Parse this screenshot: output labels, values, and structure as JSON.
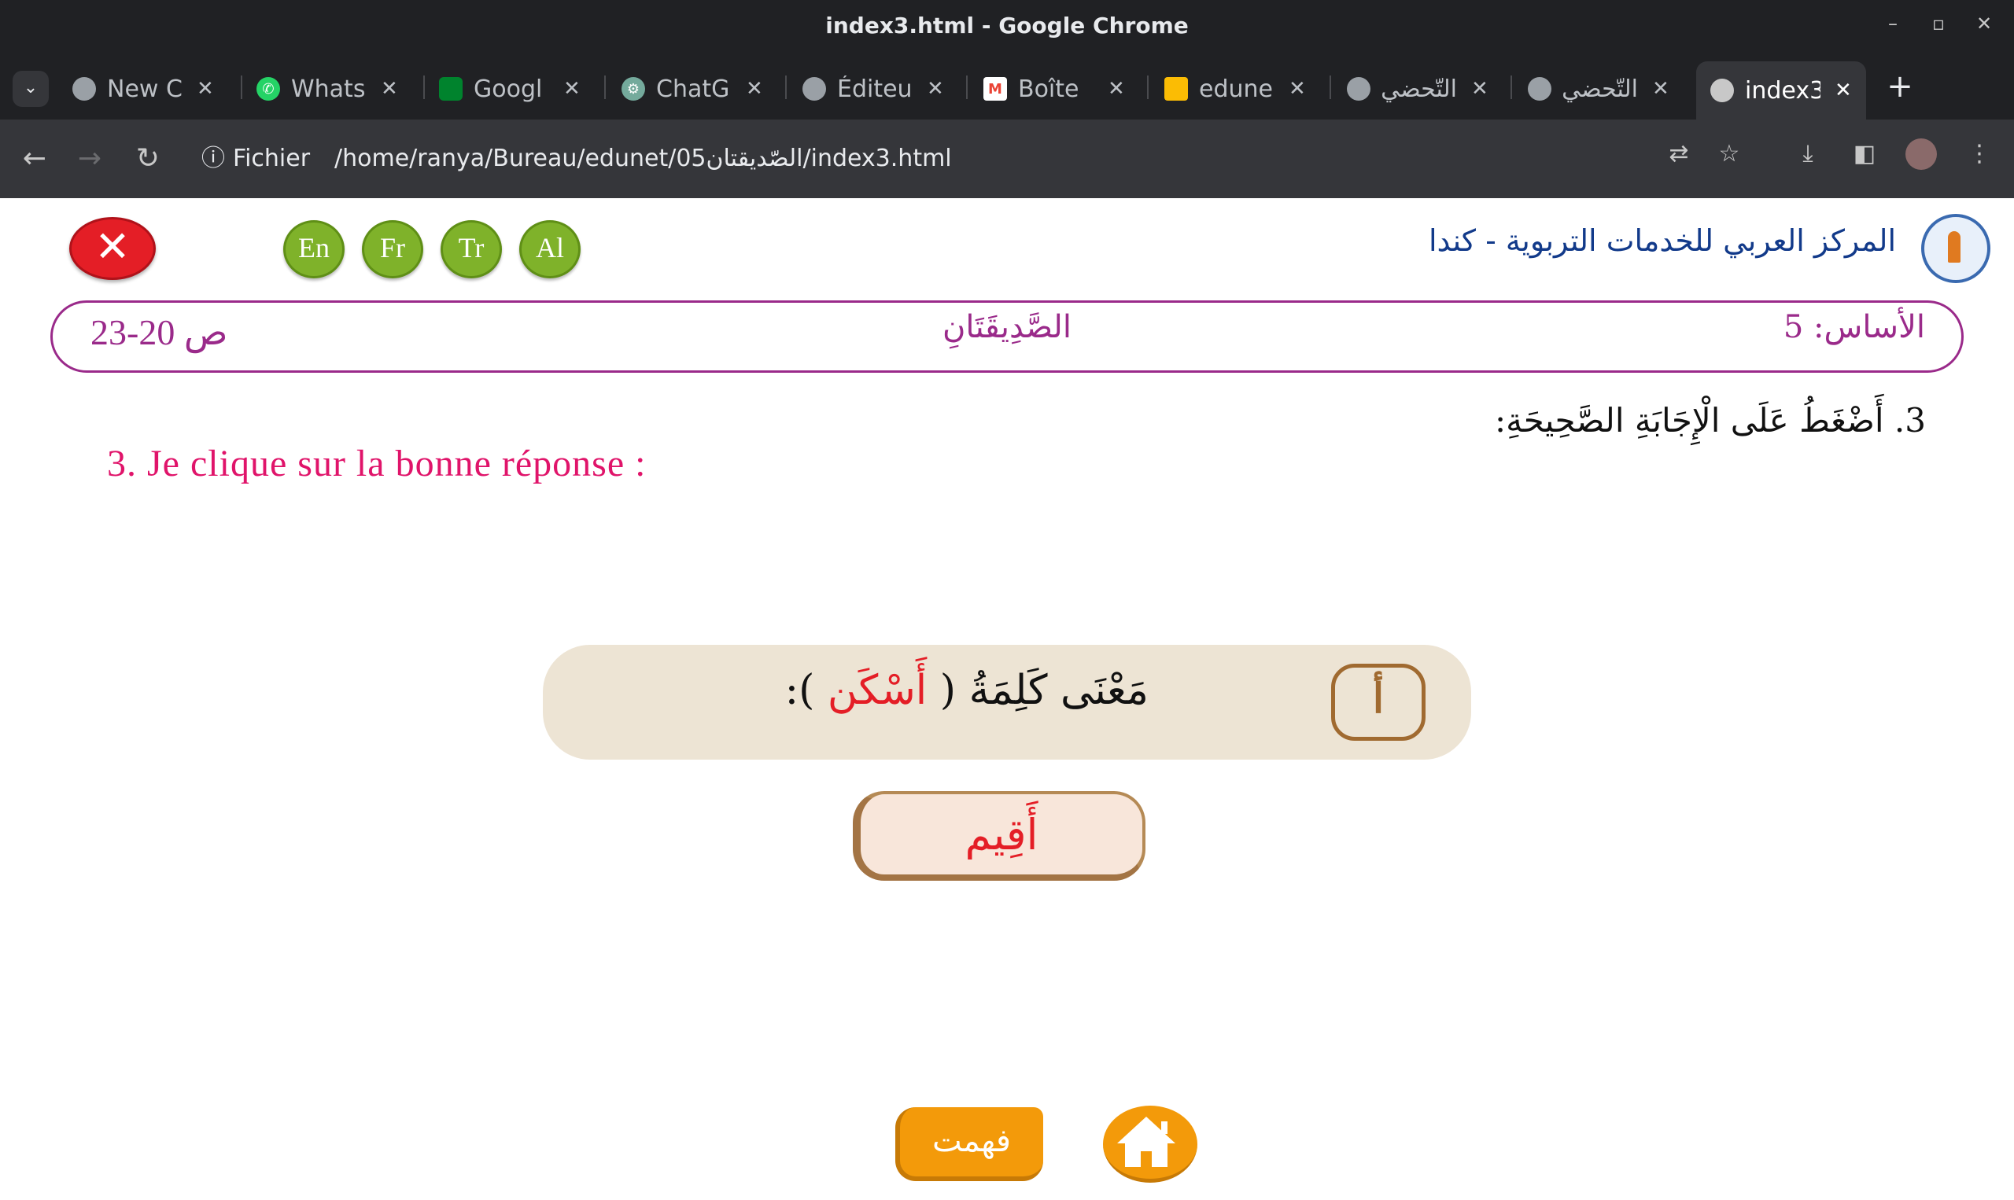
{
  "window": {
    "title": "index3.html - Google Chrome",
    "controls": [
      "–",
      "▫",
      "✕"
    ]
  },
  "tabs": [
    {
      "label": "New C",
      "icon": "globe-icon"
    },
    {
      "label": "Whats",
      "icon": "whatsapp-icon"
    },
    {
      "label": "Googl",
      "icon": "google-meet-icon"
    },
    {
      "label": "ChatG",
      "icon": "chatgpt-icon"
    },
    {
      "label": "Éditeu",
      "icon": "globe-icon"
    },
    {
      "label": "Boîte",
      "icon": "gmail-icon"
    },
    {
      "label": "edune",
      "icon": "google-drive-icon"
    },
    {
      "label": "التّحضي",
      "icon": "globe-icon"
    },
    {
      "label": "التّحضي",
      "icon": "globe-icon"
    },
    {
      "label": "index3",
      "icon": "globe-icon",
      "active": true
    }
  ],
  "toolbar": {
    "scheme_label": "Fichier",
    "url": "/home/ranya/Bureau/edunet/05الصّديقتان/index3.html"
  },
  "page": {
    "close_label": "✕",
    "languages": [
      "En",
      "Fr",
      "Tr",
      "Al"
    ],
    "org_name": "المركز العربي للخدمات التربوية - كندا",
    "header": {
      "pages": "ص 20-23",
      "lesson": "الصَّدِيقَتَانِ",
      "level": "الأساس: 5"
    },
    "instruction_ar": "3. أَضْغَطُ عَلَى الْإِجَابَةِ الصَّحِيحَةِ:",
    "instruction_fr": "3. Je clique sur la bonne réponse :",
    "question": {
      "badge": "أ",
      "prefix": "مَعْنَى كَلِمَةُ (",
      "keyword": "أَسْكَن",
      "suffix": " ):"
    },
    "answer": "أَقِيم",
    "understood_label": "فهمت"
  },
  "colors": {
    "accent_purple": "#9a2a8a",
    "french_pink": "#e0146a",
    "keyword_red": "#e41e26",
    "button_orange": "#f39a0a",
    "language_green": "#7fb22a"
  }
}
